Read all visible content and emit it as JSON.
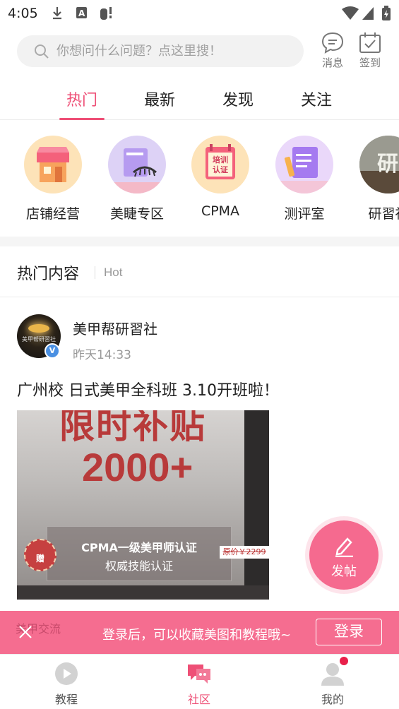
{
  "status_bar": {
    "time": "4:05"
  },
  "search": {
    "placeholder": "你想问什么问题？点这里搜！"
  },
  "header_actions": {
    "messages_label": "消息",
    "checkin_label": "签到"
  },
  "tabs": [
    {
      "label": "热门",
      "active": true
    },
    {
      "label": "最新"
    },
    {
      "label": "发现"
    },
    {
      "label": "关注"
    }
  ],
  "categories": [
    {
      "label": "店铺经营",
      "icon": "shop-icon"
    },
    {
      "label": "美睫专区",
      "icon": "eyelash-icon"
    },
    {
      "label": "CPMA",
      "icon": "training-cert-icon",
      "icon_text": "培训认证"
    },
    {
      "label": "测评室",
      "icon": "review-icon"
    },
    {
      "label": "研習社",
      "icon": "study-icon",
      "icon_text": "研"
    }
  ],
  "section": {
    "title": "热门内容",
    "subtitle": "Hot"
  },
  "post": {
    "author": "美甲帮研習社",
    "time": "昨天14:33",
    "verified_badge": "V",
    "title": "广州校 日式美甲全科班 3.10开班啦！",
    "image": {
      "headline": "限时补贴",
      "amount": "2000+",
      "cert_line1": "CPMA一级美甲师认证",
      "cert_line2": "权威技能认证",
      "stamp": "赠",
      "original_price": "原价￥2299"
    }
  },
  "fab": {
    "label": "发帖"
  },
  "login_banner": {
    "behind_text": "美甲交流",
    "message": "登录后，可以收藏美图和教程哦~",
    "button": "登录"
  },
  "bottom_nav": [
    {
      "label": "教程"
    },
    {
      "label": "社区",
      "active": true
    },
    {
      "label": "我的"
    }
  ],
  "colors": {
    "accent": "#ee4f76",
    "banner": "#f56d90"
  }
}
